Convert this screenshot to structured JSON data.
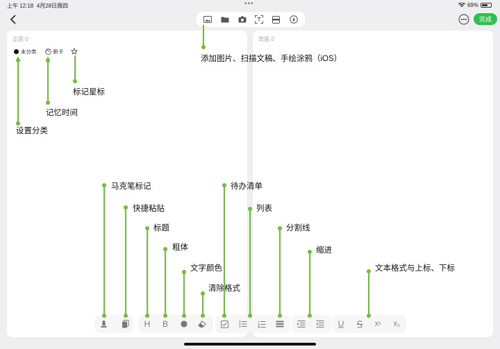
{
  "status": {
    "time": "上午 12:18",
    "date": "4月28日周四",
    "battery": "69%",
    "battery_level": 0.69
  },
  "header": {
    "done_label": "完成"
  },
  "cards": {
    "front_label": "正面",
    "front_count": "0",
    "back_label": "背面",
    "back_count": "0"
  },
  "chips": {
    "category": "未分类",
    "new_card": "新卡",
    "new_card_icon": "N"
  },
  "bottom_toolbar": {
    "heading_glyph": "H",
    "bold_glyph": "B",
    "superscript_glyph": "X²",
    "subscript_glyph": "X₂"
  },
  "annotations": {
    "insert_media": "添加图片、扫描文稿、手绘涂鸦（iOS）",
    "star": "标记星标",
    "memory_time": "记忆时间",
    "category": "设置分类",
    "marker": "马克笔标记",
    "quick_paste": "快捷粘贴",
    "heading": "标题",
    "bold": "粗体",
    "text_color": "文字颜色",
    "clear_format": "清除格式",
    "todo": "待办清单",
    "list": "列表",
    "divider": "分割线",
    "indent": "缩进",
    "text_format": "文本格式与上标、下标"
  },
  "colors": {
    "accent": "#2ec24a",
    "annotation_line": "#6cc132"
  }
}
